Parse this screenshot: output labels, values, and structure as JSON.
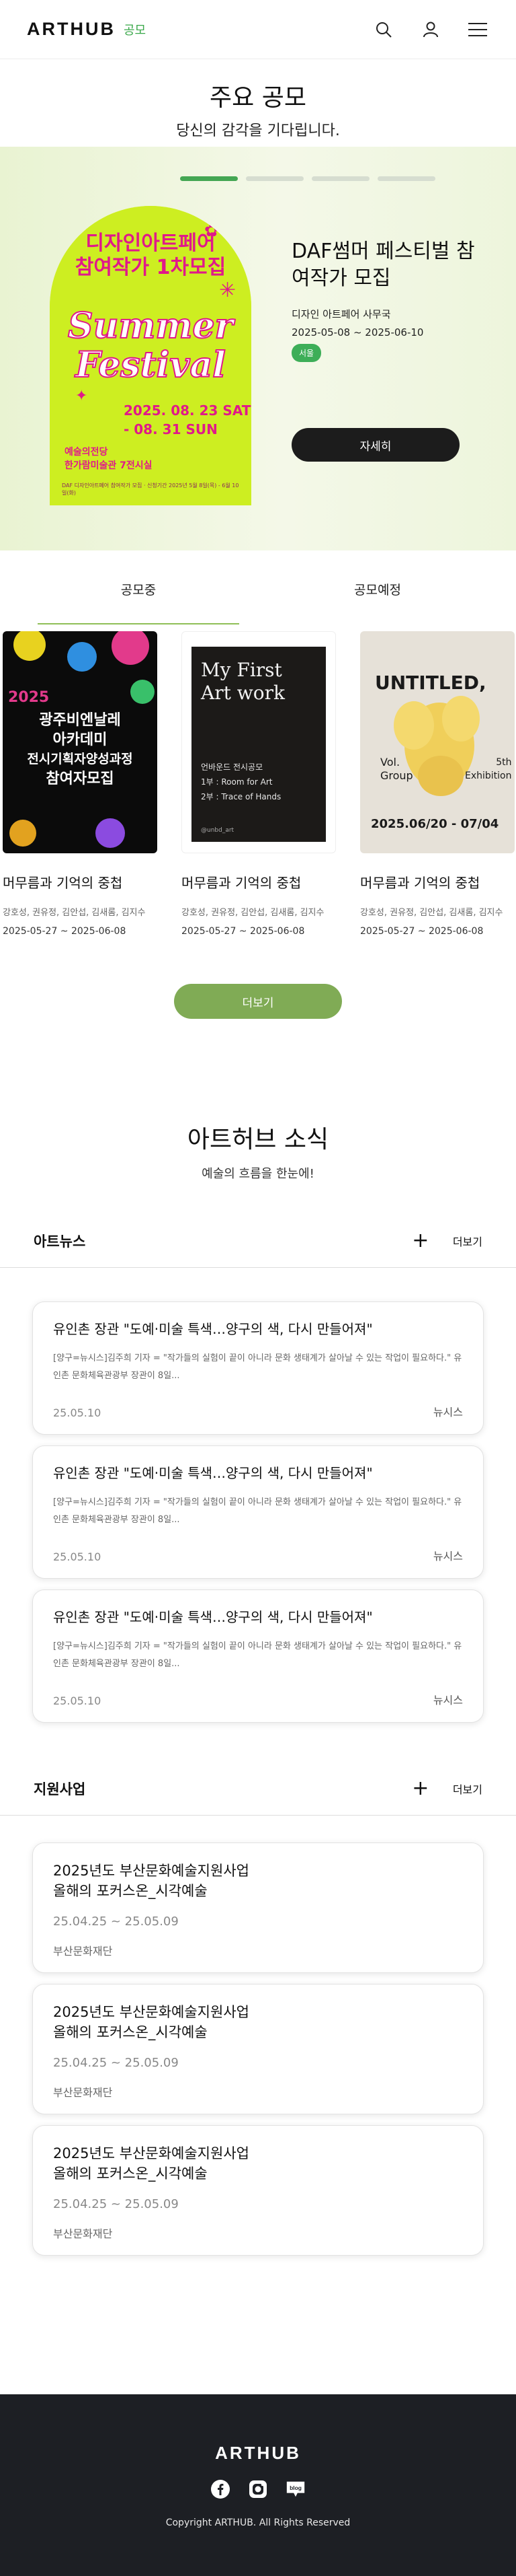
{
  "header": {
    "logo": "ARTHUB",
    "logo_sub": "공모",
    "icons": [
      "search-icon",
      "user-icon",
      "menu-icon"
    ]
  },
  "headline": {
    "title": "주요 공모",
    "subtitle": "당신의 감각을 기다립니다."
  },
  "hero": {
    "slides_total": 4,
    "active_slide": 1,
    "poster": {
      "line1": "디자인아트페어",
      "line2": "참여작가 1차모집",
      "word1": "Summer",
      "word2": "Festival",
      "date1": "2025. 08. 23 SAT",
      "date2": "- 08. 31 SUN",
      "venue1": "예술의전당",
      "venue2": "한가람미술관 7전시실",
      "foot": "DAF 디자인아트페어 참여작가 모집 · 신청기간 2025년 5월 8일(목) - 6월 10일(화)"
    },
    "title": "DAF썸머 페스티벌 참여작가 모집",
    "org": "디자인 아트페어 사무국",
    "date": "2025-05-08 ~ 2025-06-10",
    "region": "서울",
    "detail_label": "자세히"
  },
  "tabs": [
    {
      "label": "공모중"
    },
    {
      "label": "공모예정"
    }
  ],
  "cards": [
    {
      "title": "머무름과 기억의 중첩",
      "names": "강호성, 권유정, 김안섭, 김새롬, 김지수",
      "date": "2025-05-27 ~ 2025-06-08",
      "poster": {
        "lines": [
          "광주비엔날레",
          "아카데미",
          "전시기획자양성과정",
          "참여자모집"
        ],
        "year": "2025"
      }
    },
    {
      "title": "머무름과 기억의 중첩",
      "names": "강호성, 권유정, 김안섭, 김새롬, 김지수",
      "date": "2025-05-27 ~ 2025-06-08",
      "poster": {
        "title1": "My First",
        "title2": "Art work",
        "sub1": "언바운드 전시공모",
        "sub2": "1부 : Room for Art",
        "sub3": "2부 : Trace of Hands",
        "handle": "@unbd_art"
      }
    },
    {
      "title": "머무름과 기억의 중첩",
      "names": "강호성, 권유정, 김안섭, 김새롬, 김지수",
      "date": "2025-05-27 ~ 2025-06-08",
      "poster": {
        "title": "UNTITLED,",
        "vol": "Vol.",
        "group": "Group",
        "fifth": "5th",
        "exhibition": "Exhibition",
        "dates": "2025.06/20 - 07/04"
      }
    }
  ],
  "more_label": "더보기",
  "news_section": {
    "title": "아트허브 소식",
    "subtitle": "예술의 흐름을 한눈에!"
  },
  "artnews": {
    "label": "아트뉴스",
    "more": "더보기",
    "items": [
      {
        "title": "유인촌 장관 \"도예·미술 특색…양구의 색, 다시 만들어져\"",
        "body": "[양구=뉴시스]김주희 기자 = \"작가들의 실험이 끝이 아니라 문화 생태계가 살아날 수 있는 작업이 필요하다.\" 유인촌 문화체육관광부 장관이 8일...",
        "date": "25.05.10",
        "source": "뉴시스"
      },
      {
        "title": "유인촌 장관 \"도예·미술 특색…양구의 색, 다시 만들어져\"",
        "body": "[양구=뉴시스]김주희 기자 = \"작가들의 실험이 끝이 아니라 문화 생태계가 살아날 수 있는 작업이 필요하다.\" 유인촌 문화체육관광부 장관이 8일...",
        "date": "25.05.10",
        "source": "뉴시스"
      },
      {
        "title": "유인촌 장관 \"도예·미술 특색…양구의 색, 다시 만들어져\"",
        "body": "[양구=뉴시스]김주희 기자 = \"작가들의 실험이 끝이 아니라 문화 생태계가 살아날 수 있는 작업이 필요하다.\" 유인촌 문화체육관광부 장관이 8일...",
        "date": "25.05.10",
        "source": "뉴시스"
      }
    ]
  },
  "support": {
    "label": "지원사업",
    "more": "더보기",
    "items": [
      {
        "title1": "2025년도 부산문화예술지원사업",
        "title2": "올해의 포커스온_시각예술",
        "period": "25.04.25 ~ 25.05.09",
        "org": "부산문화재단"
      },
      {
        "title1": "2025년도 부산문화예술지원사업",
        "title2": "올해의 포커스온_시각예술",
        "period": "25.04.25 ~ 25.05.09",
        "org": "부산문화재단"
      },
      {
        "title1": "2025년도 부산문화예술지원사업",
        "title2": "올해의 포커스온_시각예술",
        "period": "25.04.25 ~ 25.05.09",
        "org": "부산문화재단"
      }
    ]
  },
  "footer": {
    "logo": "ARTHUB",
    "copyright": "Copyright ARTHUB. All Rights Reserved",
    "socials": [
      "facebook-icon",
      "instagram-icon",
      "blog-icon"
    ],
    "blog_label": "blog"
  },
  "colors": {
    "accent": "#3aa84a",
    "hero_bg": "#eef6dd",
    "more_button": "#80ab55",
    "footer_bg": "#1d1f24"
  }
}
